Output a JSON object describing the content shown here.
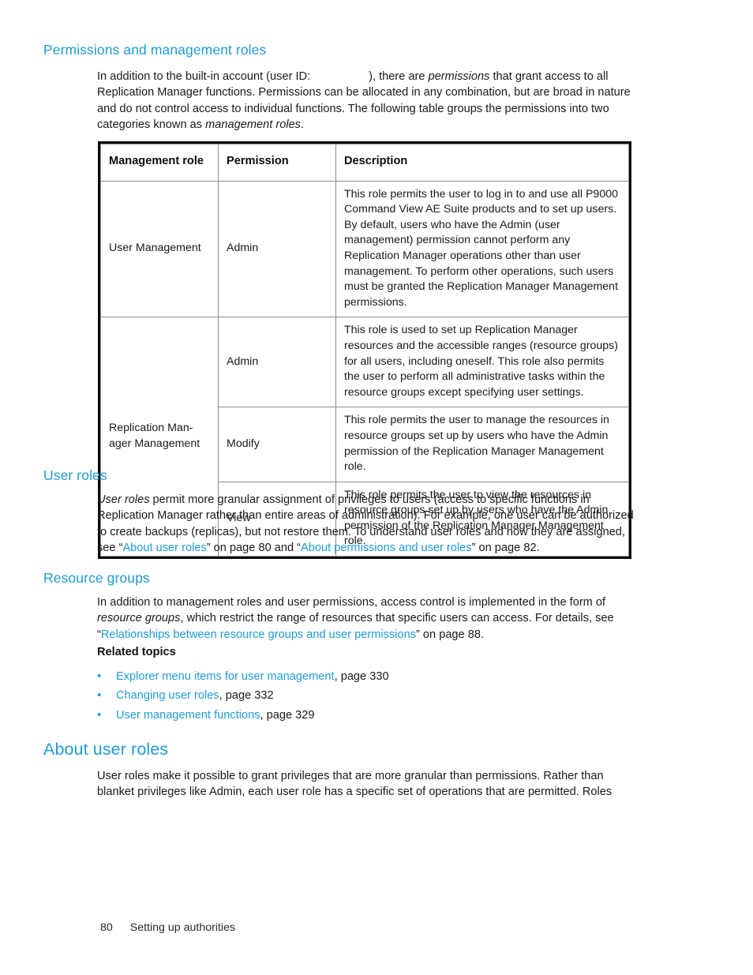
{
  "document": {
    "footer": {
      "page_number": "80",
      "section_title": "Setting up authorities"
    },
    "colors": {
      "heading": "#1f9bd6",
      "link": "#1f9bd6",
      "text": "#1a1a1a",
      "table_outer_border": "#0c0c0c",
      "table_inner_border": "#8d8d8d"
    }
  },
  "sections": {
    "permissions": {
      "heading": "Permissions and management roles",
      "paragraph": {
        "part1": "In addition to the built-in account (user ID:",
        "redacted_user_id": "",
        "part2": "), there are ",
        "italic1": "permissions",
        "part3": " that grant access to all Replication Manager functions. Permissions can be allocated in any combination, but are broad in nature and do not control access to individual functions. The following table groups the permissions into two categories known as ",
        "italic2": "management roles",
        "part4": "."
      },
      "table": {
        "headers": [
          "Management role",
          "Permission",
          "Description"
        ],
        "rows": [
          {
            "role": "User Management",
            "permission": "Admin",
            "description": "This role permits the user to log in to and use all P9000 Command View AE Suite products and to set up users. By default, users who have the Admin (user management) permission cannot perform any Replication Manager operations other than user management. To perform other operations, such users must be granted the Replication Manager Management permissions."
          },
          {
            "role": "Replication Man-ager Management",
            "permission": "Admin",
            "description": "This role is used to set up Replication Manager resources and the accessible ranges (resource groups) for all users, including oneself. This role also permits the user to perform all administrative tasks within the resource groups except specifying user settings."
          },
          {
            "role": "",
            "permission": "Modify",
            "description": "This role permits the user to manage the resources in resource groups set up by users who have the Admin permission of the Replication Manager Management role."
          },
          {
            "role": "",
            "permission": "View",
            "description": "This role permits the user to view the resources in resource groups set up by users who have the Admin permission of the Replication Manager Management role."
          }
        ]
      }
    },
    "user_roles": {
      "heading": "User roles",
      "paragraph": {
        "italic1": "User roles",
        "part1": " permit more granular assignment of privileges to users (access to specific functions in Replication Manager rather than entire areas of administration). For example, one user can be authorized to create backups (replicas), but not restore them. To understand user roles and how they are assigned, see “",
        "link1": "About user roles",
        "part2": "” on page 80 and “",
        "link2": "About permissions and user roles",
        "part3": "” on page 82."
      }
    },
    "resource_groups": {
      "heading": "Resource groups",
      "paragraph": {
        "part1": "In addition to management roles and user permissions, access control is implemented in the form of ",
        "italic1": "resource groups",
        "part2": ", which restrict the range of resources that specific users can access. For details, see “",
        "link1": "Relationships between resource groups and user permissions",
        "part3": "” on page 88."
      },
      "related_topics_label": "Related topics",
      "related_topics": [
        {
          "bullet": "•",
          "link": "Explorer menu items for user management",
          "page": ", page 330"
        },
        {
          "bullet": "•",
          "link": "Changing user roles",
          "page": ", page 332"
        },
        {
          "bullet": "•",
          "link": "User management functions",
          "page": ", page 329"
        }
      ]
    },
    "about_user_roles": {
      "heading": "About user roles",
      "paragraph": "User roles make it possible to grant privileges that are more granular than permissions. Rather than blanket privileges like Admin, each user role has a specific set of operations that are permitted. Roles"
    }
  }
}
